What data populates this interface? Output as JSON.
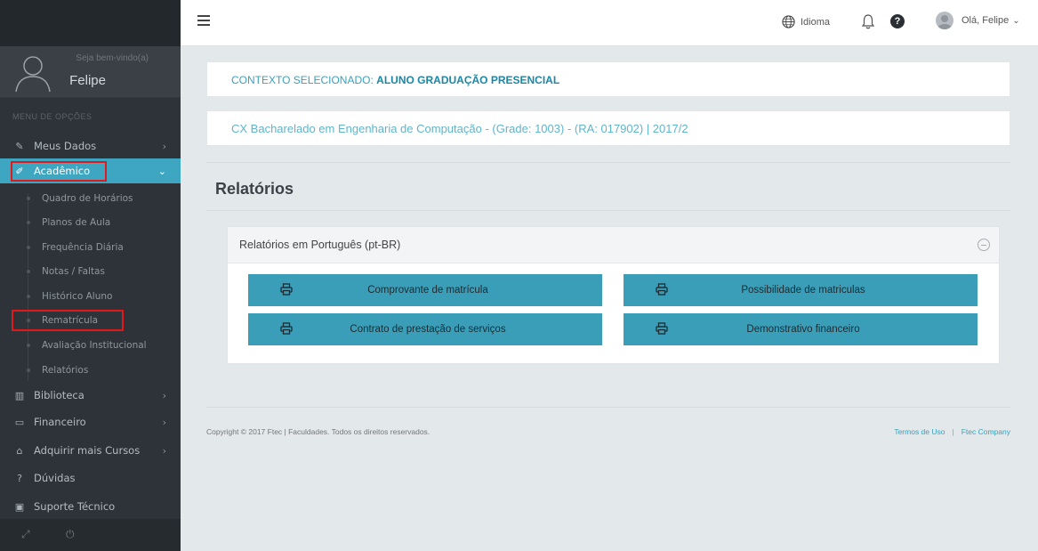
{
  "sidebar": {
    "welcome": "Seja bem-vindo(a)",
    "user_name": "Felipe",
    "menu_label": "MENU DE OPÇÕES",
    "items": {
      "meus_dados": "Meus Dados",
      "academico": "Acadêmico",
      "biblioteca": "Biblioteca",
      "financeiro": "Financeiro",
      "adquirir": "Adquirir mais Cursos",
      "duvidas": "Dúvidas",
      "suporte": "Suporte Técnico"
    },
    "academico_sub": [
      "Quadro de Horários",
      "Planos de Aula",
      "Frequência Diária",
      "Notas / Faltas",
      "Histórico Aluno",
      "Rematrícula",
      "Avaliação Institucional",
      "Relatórios"
    ],
    "accent_color": "#3fa6c2"
  },
  "topbar": {
    "language": "Idioma",
    "greeting": "Olá, Felipe"
  },
  "context": {
    "prefix": "CONTEXTO SELECIONADO: ",
    "value": "ALUNO GRADUAÇÃO PRESENCIAL"
  },
  "course": {
    "text": "CX Bacharelado em Engenharia de Computação - (Grade: 1003) - (RA: 017902) | 2017/2"
  },
  "page": {
    "title": "Relatórios"
  },
  "panel": {
    "title": "Relatórios em Português (pt-BR)",
    "buttons": {
      "comprovante": "Comprovante de matrícula",
      "possibilidade": "Possibilidade de matriculas",
      "contrato": "Contrato de prestação de serviços",
      "demonstrativo": "Demonstrativo financeiro"
    },
    "button_color": "#3a9eb8"
  },
  "footer": {
    "copyright": "Copyright © 2017 Ftec | Faculdades. Todos os direitos reservados.",
    "terms": "Termos de Uso",
    "company": "Ftec Company"
  }
}
